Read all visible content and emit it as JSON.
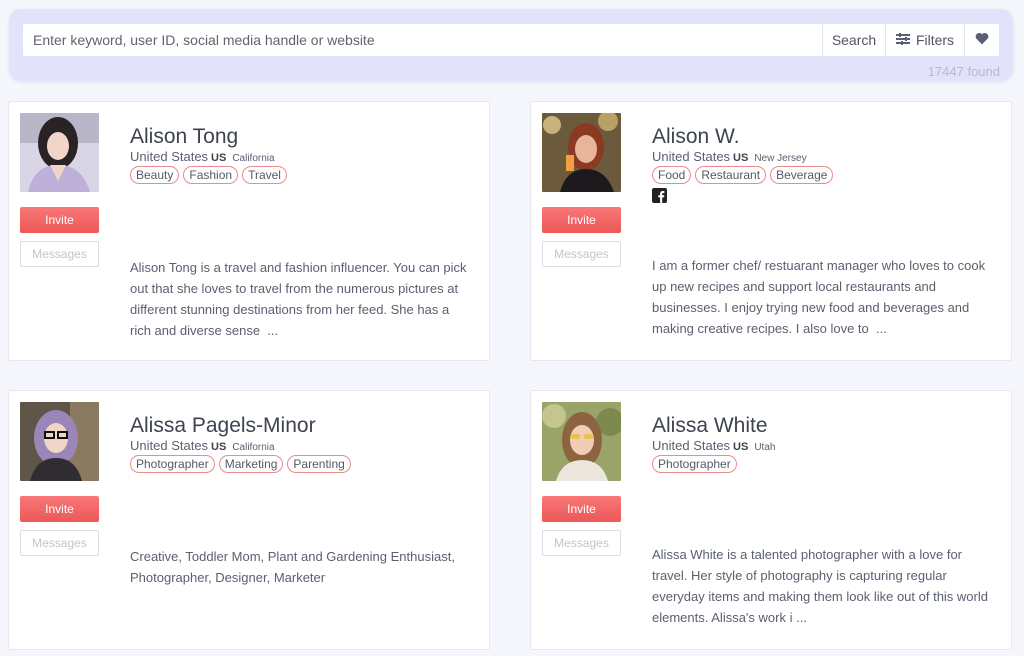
{
  "search": {
    "placeholder": "Enter keyword, user ID, social media handle or website",
    "search_label": "Search",
    "filters_label": "Filters",
    "found": "17447 found"
  },
  "colors": {
    "panel_bg": "#e2e3fb",
    "invite_red": "#f06666",
    "tag_border": "#e88d8d"
  },
  "buttons": {
    "invite": "Invite",
    "messages": "Messages"
  },
  "ellipsis": "...",
  "influencers": [
    {
      "name": "Alison Tong",
      "country": "United States",
      "country_code": "US",
      "state": "California",
      "tags": [
        "Beauty",
        "Fashion",
        "Travel"
      ],
      "social": [],
      "bio": "Alison Tong is a travel and fashion influencer. You can pick out that she loves to travel from the numerous pictures at different stunning destinations from her feed. She has a rich and diverse sense"
    },
    {
      "name": "Alison W.",
      "country": "United States",
      "country_code": "US",
      "state": "New Jersey",
      "tags": [
        "Food",
        "Restaurant",
        "Beverage"
      ],
      "social": [
        "facebook-icon"
      ],
      "bio": "I am a former chef/ restuarant manager who loves to cook up new recipes and support local restaurants and businesses. I enjoy trying new food and beverages and making creative recipes. I also love to"
    },
    {
      "name": "Alissa Pagels-Minor",
      "country": "United States",
      "country_code": "US",
      "state": "California",
      "tags": [
        "Photographer",
        "Marketing",
        "Parenting"
      ],
      "social": [],
      "bio": "Creative, Toddler Mom, Plant and Gardening Enthusiast, Photographer, Designer, Marketer"
    },
    {
      "name": "Alissa White",
      "country": "United States",
      "country_code": "US",
      "state": "Utah",
      "tags": [
        "Photographer"
      ],
      "social": [],
      "bio": "Alissa White is a talented photographer with a love for travel. Her style of photography is capturing regular everyday items and making them look like out of this world elements. Alissa's work i"
    }
  ]
}
